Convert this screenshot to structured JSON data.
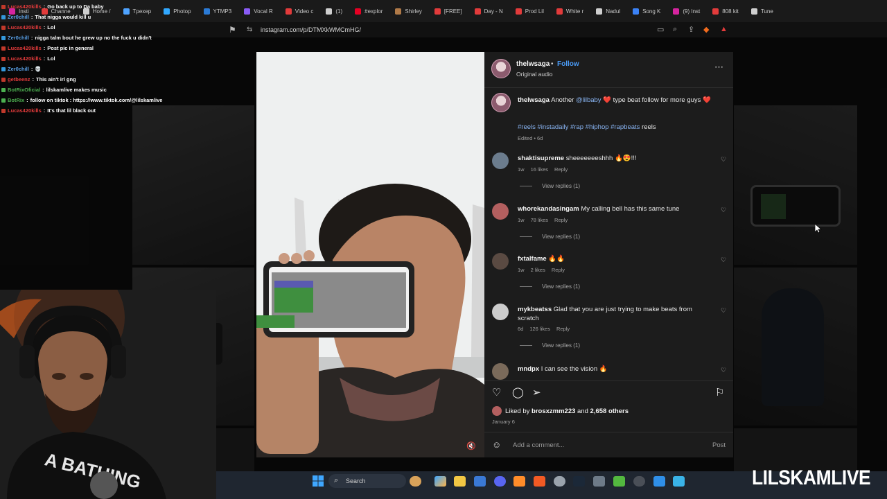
{
  "browser": {
    "tabs": [
      {
        "label": "Insti",
        "color": "#d6249f"
      },
      {
        "label": "Channe",
        "color": "#e23b3b"
      },
      {
        "label": "Home /",
        "color": "#cfcfcf"
      },
      {
        "label": "Tpexep",
        "color": "#4ea3ff"
      },
      {
        "label": "Photop",
        "color": "#31a8ff"
      },
      {
        "label": "YTMP3",
        "color": "#2b7bd6"
      },
      {
        "label": "Vocal R",
        "color": "#8a5cf6"
      },
      {
        "label": "Video c",
        "color": "#e23b3b"
      },
      {
        "label": "(1)",
        "color": "#cfcfcf"
      },
      {
        "label": "#explor",
        "color": "#e60023"
      },
      {
        "label": "Shirley",
        "color": "#b07a48"
      },
      {
        "label": "[FREE]",
        "color": "#e23b3b"
      },
      {
        "label": "Day - N",
        "color": "#e23b3b"
      },
      {
        "label": "Prod Lil",
        "color": "#e23b3b"
      },
      {
        "label": "White r",
        "color": "#e23b3b"
      },
      {
        "label": "Nadul",
        "color": "#cfcfcf"
      },
      {
        "label": "Song K",
        "color": "#3b82f6"
      },
      {
        "label": "(9) Inst",
        "color": "#d6249f"
      },
      {
        "label": "808 kit",
        "color": "#e23b3b"
      },
      {
        "label": "Tune",
        "color": "#cfcfcf"
      }
    ],
    "url": "instagram.com/p/DTMXkWMCmHG/"
  },
  "chat": [
    {
      "user": "Lucas420kills",
      "user_color": "#e33b3b",
      "msg": "Go back up to Da baby",
      "badge": "#c0392b"
    },
    {
      "user": "Zer0chill",
      "user_color": "#5aa0e6",
      "msg": "That nigga would kill u",
      "badge": "#3498db"
    },
    {
      "user": "Lucas420kills",
      "user_color": "#e33b3b",
      "msg": "Lol",
      "badge": "#c0392b"
    },
    {
      "user": "Zer0chill",
      "user_color": "#5aa0e6",
      "msg": "nigga talm bout he grew up no the fuck u didn't",
      "badge": "#3498db"
    },
    {
      "user": "Lucas420kills",
      "user_color": "#e33b3b",
      "msg": "Post pic in general",
      "badge": "#c0392b"
    },
    {
      "user": "Lucas420kills",
      "user_color": "#e33b3b",
      "msg": "Lol",
      "badge": "#c0392b"
    },
    {
      "user": "Zer0chill",
      "user_color": "#5aa0e6",
      "msg": "💀",
      "badge": "#3498db"
    },
    {
      "user": "getbeenz",
      "user_color": "#e33b3b",
      "msg": "This ain't irl gng",
      "badge": "#c0392b"
    },
    {
      "user": "BotRixOficial",
      "user_color": "#4caf50",
      "msg": "lilskamlive makes music",
      "badge": "#4caf50"
    },
    {
      "user": "BotRix",
      "user_color": "#4caf50",
      "msg": "follow on tiktok : https://www.tiktok.com/@lilskamlive",
      "badge": "#4caf50"
    },
    {
      "user": "Lucas420kills",
      "user_color": "#e33b3b",
      "msg": "It's that lil black out",
      "badge": "#c0392b"
    }
  ],
  "post": {
    "username": "thelwsaga",
    "follow_label": "Follow",
    "audio": "Original audio",
    "more_icon": "more-dots-icon",
    "caption": {
      "username": "thelwsaga",
      "text_before": "Another",
      "mention": "@lilbaby",
      "text_after": "❤️ type beat follow for more guys ❤️",
      "hashtags": "#reels #instadaily #rap #hiphop #rapbeats",
      "hashtags_tail": "reels",
      "meta": "Edited • 6d"
    },
    "comments": [
      {
        "username": "shaktisupreme",
        "text": "sheeeeeeeshhh 🔥😍!!!",
        "time": "1w",
        "likes": "16 likes",
        "reply": "Reply",
        "view_replies": "View replies (1)",
        "avatar_color": "#6b7c8d"
      },
      {
        "username": "whorekandasingam",
        "text": "My calling bell has this same tune",
        "time": "1w",
        "likes": "78 likes",
        "reply": "Reply",
        "view_replies": "View replies (1)",
        "avatar_color": "#b35f5f"
      },
      {
        "username": "fxtalfame",
        "text": "🔥🔥",
        "time": "1w",
        "likes": "2 likes",
        "reply": "Reply",
        "view_replies": "View replies (1)",
        "avatar_color": "#5a4a42"
      },
      {
        "username": "mykbeatss",
        "text": "Glad that you are just trying to make beats from scratch",
        "time": "6d",
        "likes": "126 likes",
        "reply": "Reply",
        "view_replies": "View replies (1)",
        "avatar_color": "#cccccc"
      },
      {
        "username": "mndpx",
        "text": "I can see the vision 🔥",
        "avatar_color": "#7a6a5a"
      }
    ],
    "liked_by_prefix": "Liked by",
    "liked_by_user": "brosxzmm223",
    "liked_by_mid": "and",
    "liked_by_others": "2,658 others",
    "date": "January 6",
    "comment_placeholder": "Add a comment...",
    "post_label": "Post"
  },
  "taskbar": {
    "search_label": "Search"
  },
  "watermark": "LILSKAMLIVE"
}
